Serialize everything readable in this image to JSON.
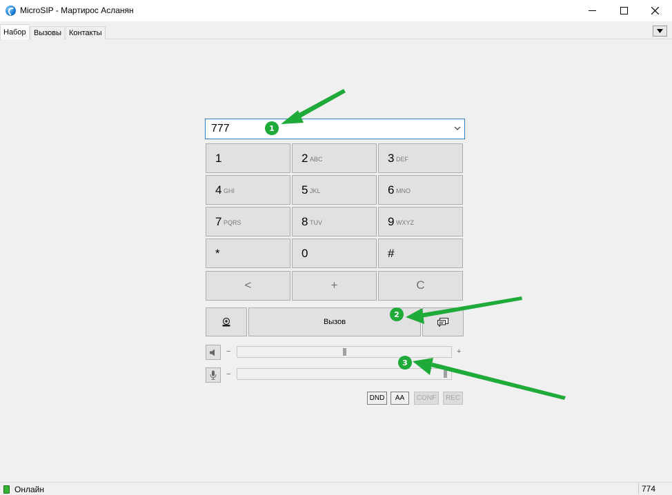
{
  "window": {
    "title": "MicroSIP - Мартирос Асланян"
  },
  "tabs": [
    {
      "label": "Набор",
      "active": true
    },
    {
      "label": "Вызовы",
      "active": false
    },
    {
      "label": "Контакты",
      "active": false
    }
  ],
  "dialer": {
    "number": "777",
    "keys": [
      {
        "digit": "1",
        "letters": ""
      },
      {
        "digit": "2",
        "letters": "ABC"
      },
      {
        "digit": "3",
        "letters": "DEF"
      },
      {
        "digit": "4",
        "letters": "GHI"
      },
      {
        "digit": "5",
        "letters": "JKL"
      },
      {
        "digit": "6",
        "letters": "MNO"
      },
      {
        "digit": "7",
        "letters": "PQRS"
      },
      {
        "digit": "8",
        "letters": "TUV"
      },
      {
        "digit": "9",
        "letters": "WXYZ"
      },
      {
        "digit": "*",
        "letters": ""
      },
      {
        "digit": "0",
        "letters": ""
      },
      {
        "digit": "#",
        "letters": ""
      }
    ],
    "controls": {
      "backspace": "<",
      "plus": "+",
      "clear": "C"
    },
    "call_label": "Вызов"
  },
  "audio": {
    "speaker": {
      "minus": "−",
      "plus": "+",
      "level": 0.5
    },
    "microphone": {
      "minus": "−",
      "level": 0.98
    }
  },
  "toggles": {
    "dnd": "DND",
    "aa": "AA",
    "conf": "CONF",
    "rec": "REC"
  },
  "annotations": {
    "one": "1",
    "two": "2",
    "three": "3",
    "color": "#1faa3a"
  },
  "status": {
    "text": "Онлайн",
    "count": "774"
  }
}
